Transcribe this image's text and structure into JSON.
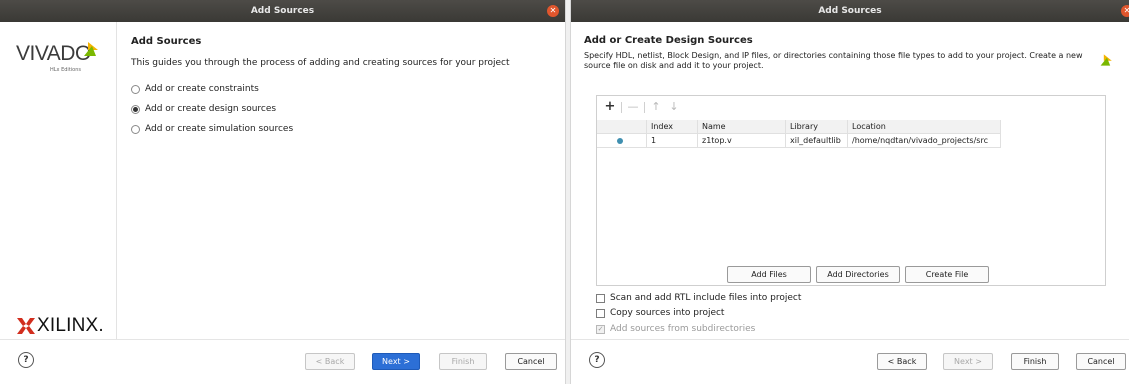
{
  "dialog1": {
    "title": "Add Sources",
    "brand": {
      "vivado": "VIVADO",
      "edition": "HLx Editions",
      "xilinx": "XILINX."
    },
    "heading": "Add Sources",
    "description": "This guides you through the process of adding and creating sources for your project",
    "options": [
      {
        "label": "Add or create constraints",
        "selected": false
      },
      {
        "label": "Add or create design sources",
        "selected": true
      },
      {
        "label": "Add or create simulation sources",
        "selected": false
      }
    ],
    "footer": {
      "help": "?",
      "back": "< Back",
      "next": "Next >",
      "finish": "Finish",
      "cancel": "Cancel"
    }
  },
  "dialog2": {
    "title": "Add Sources",
    "heading": "Add or Create Design Sources",
    "description": "Specify HDL, netlist, Block Design, and IP files, or directories containing those file types to add to your project. Create a new source file on disk and add it to your project.",
    "toolbar": {
      "add": "+",
      "remove": "—",
      "up": "↑",
      "down": "↓"
    },
    "table": {
      "headers": [
        "",
        "Index",
        "Name",
        "Library",
        "Location"
      ],
      "rows": [
        {
          "index": "1",
          "name": "z1top.v",
          "library": "xil_defaultlib",
          "location": "/home/nqdtan/vivado_projects/src"
        }
      ]
    },
    "buttons": {
      "add_files": "Add Files",
      "add_directories": "Add Directories",
      "create_file": "Create File"
    },
    "checkboxes": [
      {
        "label": "Scan and add RTL include files into project",
        "checked": false,
        "disabled": false
      },
      {
        "label": "Copy sources into project",
        "checked": false,
        "disabled": false
      },
      {
        "label": "Add sources from subdirectories",
        "checked": true,
        "disabled": true
      }
    ],
    "footer": {
      "help": "?",
      "back": "< Back",
      "next": "Next >",
      "finish": "Finish",
      "cancel": "Cancel"
    }
  },
  "colors": {
    "accent": "#2c6fd6",
    "titlebar": "#3f3e3a",
    "close": "#e0562d",
    "status_dot": "#3f8fb0",
    "logo_green": "#7ab800",
    "logo_yellow": "#f5b400"
  }
}
